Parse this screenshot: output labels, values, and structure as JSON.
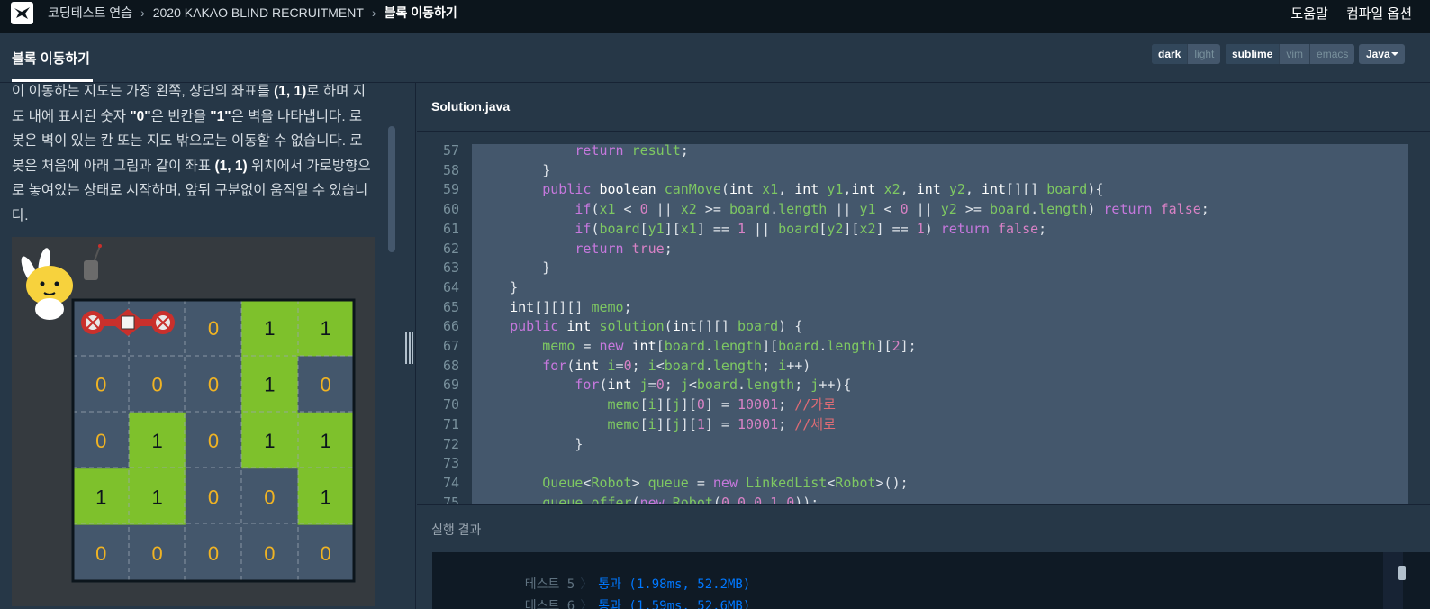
{
  "nav": {
    "breadcrumbs": [
      "코딩테스트 연습",
      "2020 KAKAO BLIND RECRUITMENT",
      "블록 이동하기"
    ],
    "help": "도움말",
    "compile_options": "컴파일 옵션"
  },
  "header": {
    "problem_title": "블록 이동하기",
    "themes": [
      "dark",
      "light"
    ],
    "keymaps": [
      "sublime",
      "vim",
      "emacs"
    ],
    "language": "Java"
  },
  "description": {
    "lines": [
      "이 이동하는 지도는 가장 왼쪽, 상단의 좌표를 (1, 1)로 하며 지",
      "도 내에 표시된 숫자 \"0\"은 빈칸을 \"1\"은 벽을 나타냅니다. 로",
      "봇은 벽이 있는 칸 또는 지도 밖으로는 이동할 수 없습니다. 로",
      "봇은 처음에 아래 그림과 같이 좌표 (1, 1) 위치에서 가로방향으",
      "로 놓여있는 상태로 시작하며, 앞뒤 구분없이 움직일 수 있습니",
      "다."
    ]
  },
  "figure": {
    "grid": [
      [
        "",
        "",
        "0",
        "1",
        "1"
      ],
      [
        "0",
        "0",
        "0",
        "1",
        "0"
      ],
      [
        "0",
        "1",
        "0",
        "1",
        "1"
      ],
      [
        "1",
        "1",
        "0",
        "0",
        "1"
      ],
      [
        "0",
        "0",
        "0",
        "0",
        "0"
      ]
    ],
    "colors": {
      "wall": "#7ec12c",
      "empty": "#44576c",
      "digit_empty": "#f0b323",
      "digit_wall": "#0c151c"
    }
  },
  "editor": {
    "file_name": "Solution.java",
    "line_numbers": [
      "57",
      "58",
      "59",
      "60",
      "61",
      "62",
      "63",
      "64",
      "65",
      "66",
      "67",
      "68",
      "69",
      "70",
      "71",
      "72",
      "73",
      "74",
      "75"
    ]
  },
  "result": {
    "title": "실행 결과",
    "rows": [
      {
        "label": "테스트 5",
        "status": "통과",
        "detail": "(1.98ms, 52.2MB)"
      },
      {
        "label": "테스트 6",
        "status": "통과",
        "detail": "(1.59ms, 52.6MB)"
      }
    ]
  }
}
